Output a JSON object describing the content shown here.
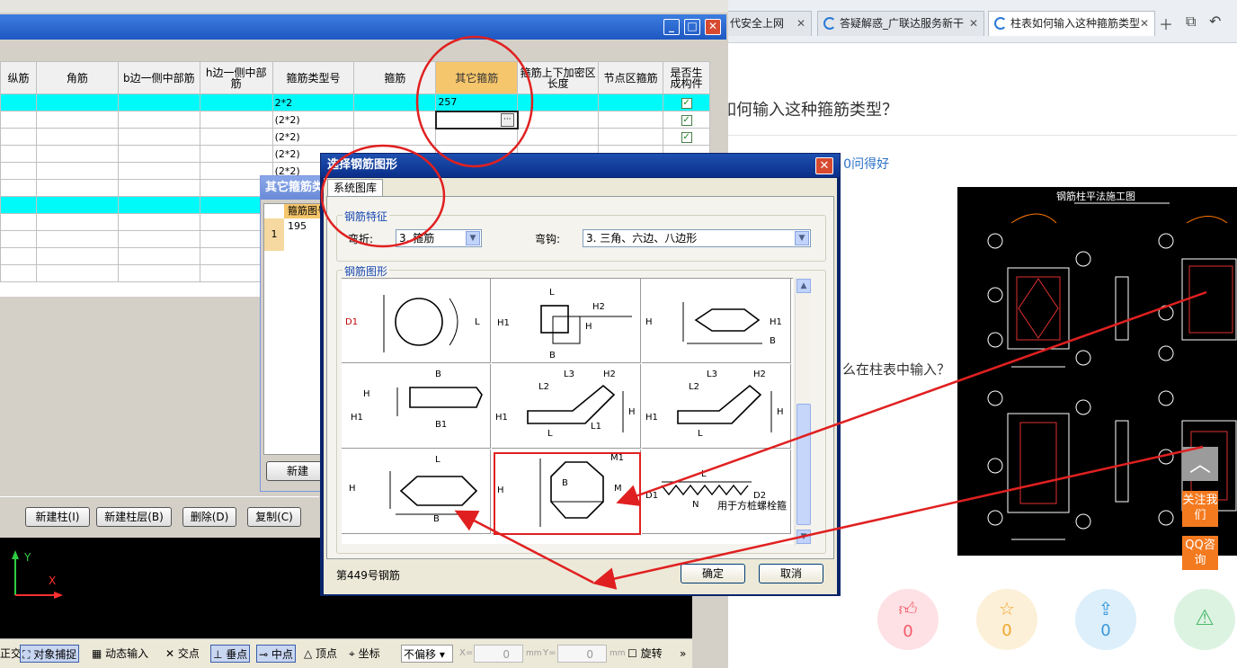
{
  "browser": {
    "tabs": [
      {
        "label": "代安全上网"
      },
      {
        "label": "答疑解惑_广联达服务新干"
      },
      {
        "label": "柱表如何输入这种箍筋类型"
      }
    ],
    "question_title": "如何输入这种箍筋类型？",
    "question_meta": "| 0问得好",
    "question_body": "么在柱表中输入？",
    "image_caption": "钢筋柱平法施工图",
    "follow_label": "关注我们",
    "qq_label": "QQ咨询",
    "reactions": [
      {
        "icon": "thumbs-up-icon",
        "count": "0",
        "color": "#f2596a"
      },
      {
        "icon": "star-icon",
        "count": "0",
        "color": "#f0a52a"
      },
      {
        "icon": "share-icon",
        "count": "0",
        "color": "#3a98d9"
      },
      {
        "icon": "warning-icon",
        "count": "",
        "color": "#4cb96a"
      }
    ]
  },
  "grid": {
    "columns": [
      "纵筋",
      "角筋",
      "b边一侧中部筋",
      "h边一侧中部筋",
      "箍筋类型号",
      "箍筋",
      "其它箍筋",
      "箍筋上下加密区长度",
      "节点区箍筋",
      "是否生成构件"
    ],
    "rows": [
      {
        "type": "2*2",
        "other": "257",
        "checked": true,
        "cyan": true
      },
      {
        "type": "(2*2)",
        "other": "",
        "checked": true,
        "cyan": false
      },
      {
        "type": "(2*2)",
        "other": "",
        "checked": true,
        "cyan": false
      },
      {
        "type": "(2*2)",
        "other": "",
        "checked": false,
        "cyan": false
      },
      {
        "type": "(2*2)",
        "other": "",
        "checked": false,
        "cyan": false
      }
    ]
  },
  "bg_dialog": {
    "title": "其它箍筋类型",
    "col_header": "箍筋图号",
    "row_num": "1",
    "row_value": "195",
    "new_button": "新建"
  },
  "buttons": [
    "新建柱(I)",
    "新建柱层(B)",
    "删除(D)",
    "复制(C)"
  ],
  "status": {
    "items": [
      "正交",
      "对象捕捉",
      "动态输入",
      "交点",
      "垂点",
      "中点",
      "顶点",
      "坐标",
      "不偏移",
      "X=",
      "0",
      "mm",
      "Y=",
      "0",
      "mm",
      "旋转"
    ]
  },
  "dialog": {
    "title": "选择钢筋图形",
    "tab": "系统图库",
    "feature_group": "钢筋特征",
    "bend_label": "弯折:",
    "bend_value": "3. 箍筋",
    "hook_label": "弯钩:",
    "hook_value": "3. 三角、六边、八边形",
    "shape_group": "钢筋图形",
    "status_text": "第449号钢筋",
    "ok": "确定",
    "cancel": "取消",
    "cells": [
      {
        "labels": [
          "D1",
          "L"
        ]
      },
      {
        "labels": [
          "L",
          "H2",
          "H1",
          "H",
          "B"
        ]
      },
      {
        "labels": [
          "H",
          "H1",
          "B"
        ]
      },
      {
        "labels": [
          "B",
          "H",
          "H1",
          "B1"
        ]
      },
      {
        "labels": [
          "L3",
          "H2",
          "L2",
          "H1",
          "H",
          "L",
          "L1"
        ]
      },
      {
        "labels": [
          "L3",
          "H2",
          "L2",
          "H1",
          "H",
          "L"
        ]
      },
      {
        "labels": [
          "L",
          "H",
          "B"
        ]
      },
      {
        "labels": [
          "M1",
          "B",
          "H",
          "M"
        ]
      },
      {
        "labels": [
          "L",
          "D1",
          "D2",
          "N"
        ],
        "caption": "用于方桩螺栓箍"
      }
    ]
  },
  "axis": {
    "x": "X",
    "y": "Y"
  },
  "colors": {
    "accent": "#f6c66c",
    "cyan": "#00fafa",
    "annotation": "#e02020"
  }
}
